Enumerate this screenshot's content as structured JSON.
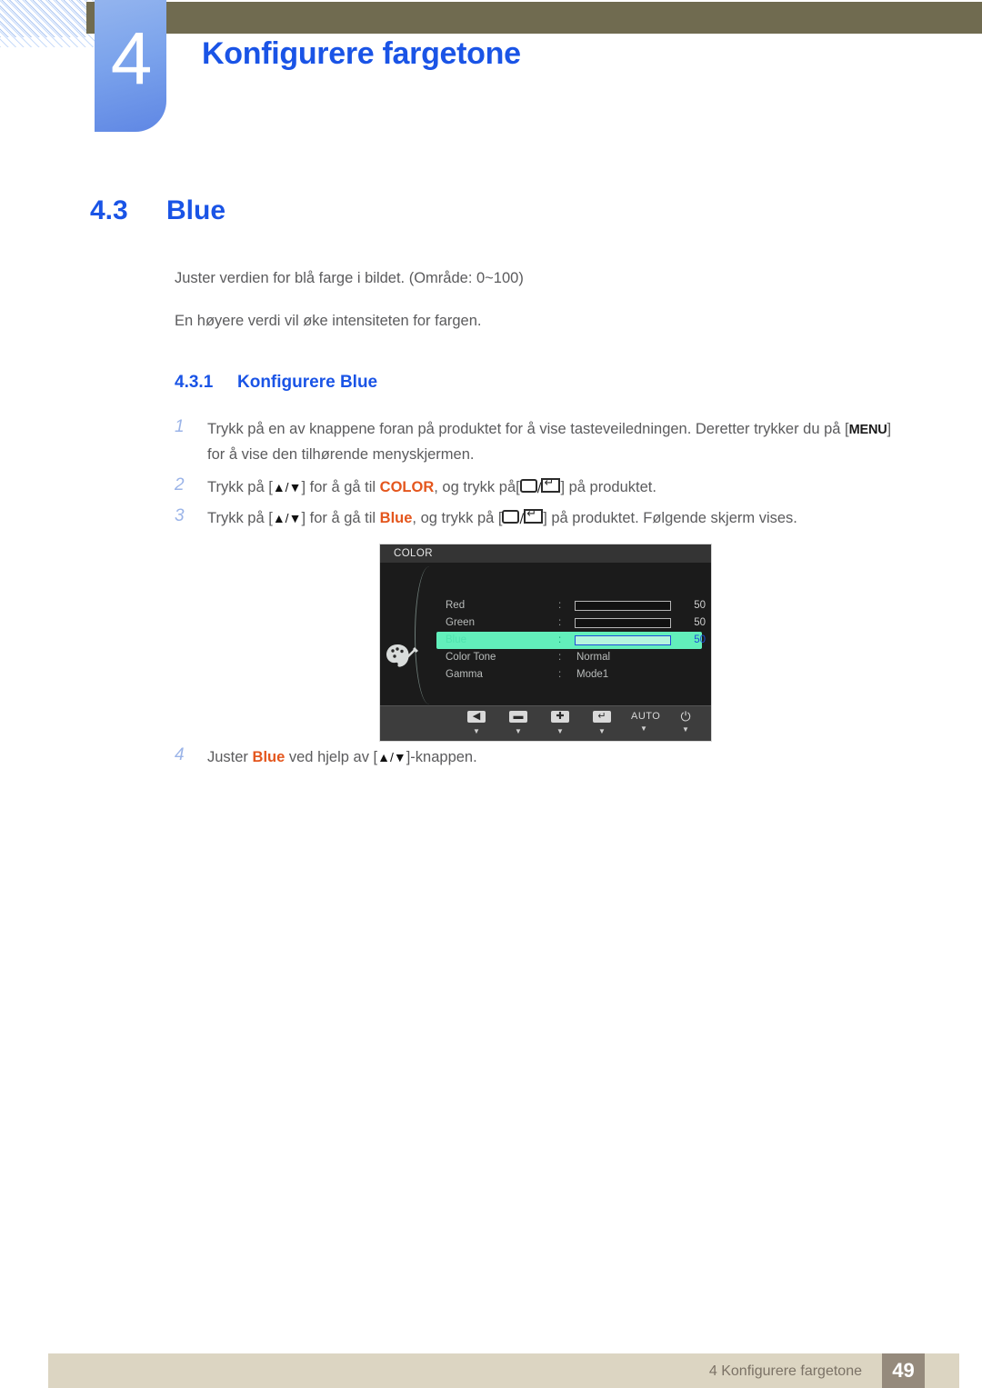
{
  "header": {
    "chapter_number": "4",
    "chapter_title": "Konfigurere fargetone"
  },
  "section": {
    "number": "4.3",
    "title": "Blue",
    "paragraph_1": "Juster verdien for blå farge i bildet. (Område: 0~100)",
    "paragraph_2": "En høyere verdi vil øke intensiteten for fargen."
  },
  "subsection": {
    "number": "4.3.1",
    "title": "Konfigurere Blue"
  },
  "steps": [
    {
      "num": "1",
      "text_a": "Trykk på en av knappene foran på produktet for å vise tasteveiledningen. Deretter trykker du på [",
      "key": "MENU",
      "text_b": "] for å vise den tilhørende menyskjermen."
    },
    {
      "num": "2",
      "text_a": "Trykk på [",
      "arrows": "▲/▼",
      "text_b": "] for å gå til ",
      "keyword": "COLOR",
      "text_c": ", og trykk på[",
      "text_d": "] på produktet."
    },
    {
      "num": "3",
      "text_a": "Trykk på [",
      "arrows": "▲/▼",
      "text_b": "] for å gå til ",
      "keyword": "Blue",
      "text_c": ", og trykk på [",
      "text_d": "] på produktet. Følgende skjerm vises."
    },
    {
      "num": "4",
      "text_a": "Juster ",
      "keyword": "Blue",
      "text_b": " ved hjelp av [",
      "arrows": "▲/▼",
      "text_c": "]-knappen."
    }
  ],
  "osd": {
    "title": "COLOR",
    "icon": "palette-icon",
    "rows": [
      {
        "label": "Red",
        "colon": ":",
        "type": "slider",
        "fill_pct": 50,
        "value": "50",
        "selected": false
      },
      {
        "label": "Green",
        "colon": ":",
        "type": "slider",
        "fill_pct": 50,
        "value": "50",
        "selected": false
      },
      {
        "label": "Blue",
        "colon": ":",
        "type": "slider",
        "fill_pct": 50,
        "value": "50",
        "selected": true
      },
      {
        "label": "Color Tone",
        "colon": ":",
        "type": "text",
        "value": "Normal",
        "selected": false
      },
      {
        "label": "Gamma",
        "colon": ":",
        "type": "text",
        "value": "Mode1",
        "selected": false
      }
    ],
    "buttons": [
      {
        "name": "back-button",
        "glyph": "◀",
        "kind": "icon"
      },
      {
        "name": "minus-button",
        "glyph": "▬",
        "kind": "icon"
      },
      {
        "name": "plus-button",
        "glyph": "✚",
        "kind": "icon"
      },
      {
        "name": "enter-button",
        "glyph": "↵",
        "kind": "icon"
      },
      {
        "name": "auto-button",
        "glyph": "AUTO",
        "kind": "text"
      },
      {
        "name": "power-button",
        "glyph": "⏻",
        "kind": "power"
      }
    ]
  },
  "footer": {
    "text": "4 Konfigurere fargetone",
    "page": "49"
  },
  "colors": {
    "accent_blue": "#1a54e6",
    "keyword_orange": "#e4561d",
    "olive_bar": "#706b50",
    "footer_bg": "#dcd5c2",
    "page_box": "#958a7c",
    "osd_bg": "#1b1b1b",
    "osd_highlight": "#62efbb",
    "osd_slider_blue": "#1f56e8"
  }
}
